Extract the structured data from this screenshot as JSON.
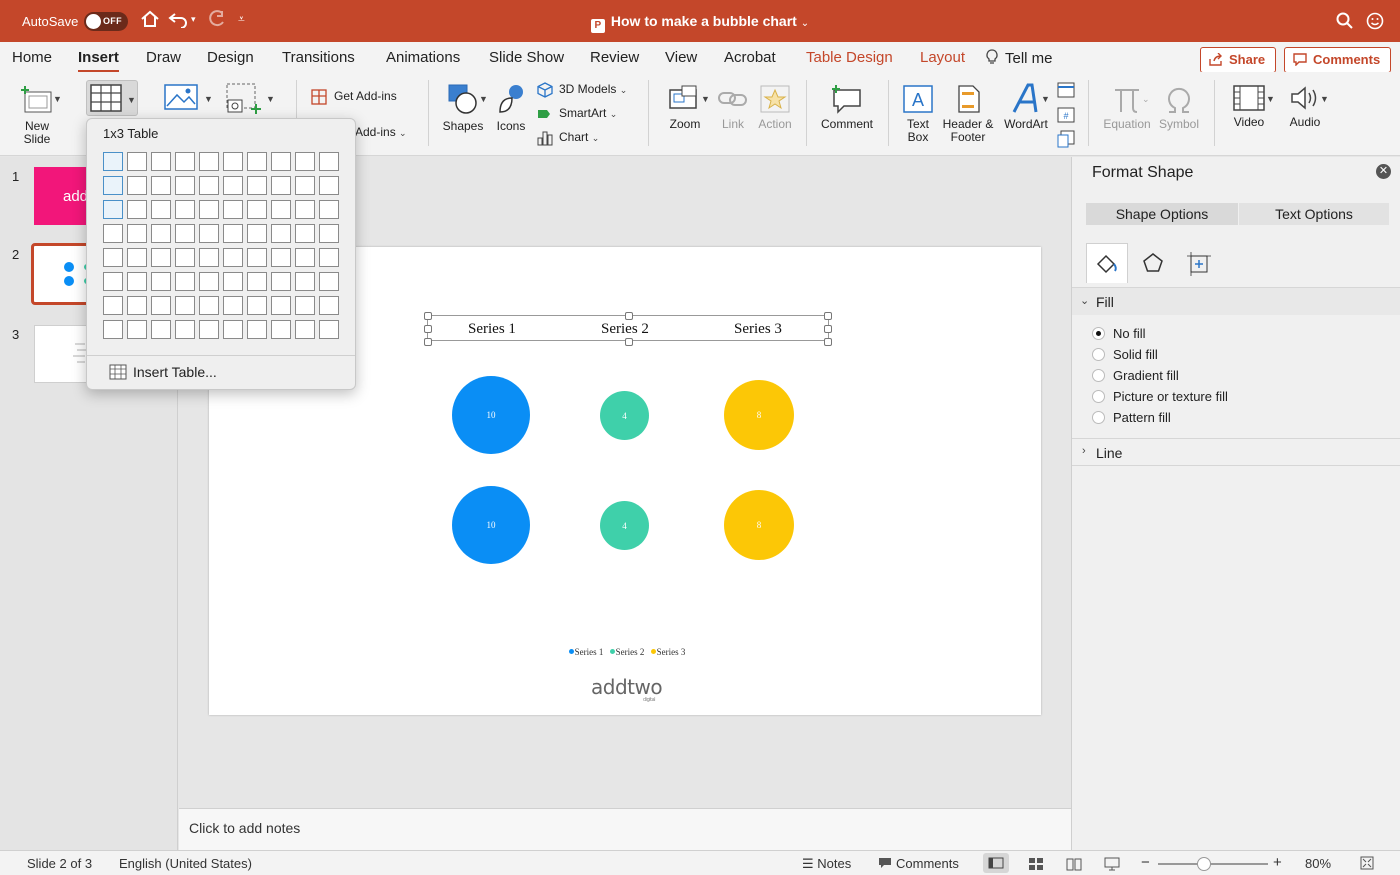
{
  "titlebar": {
    "autosave_label": "AutoSave",
    "autosave_state": "OFF",
    "doc_title": "How to make a bubble chart",
    "app_badge": "P",
    "accent_color": "#c4472a"
  },
  "tabs": {
    "home": "Home",
    "insert": "Insert",
    "draw": "Draw",
    "design": "Design",
    "transitions": "Transitions",
    "animations": "Animations",
    "slide_show": "Slide Show",
    "review": "Review",
    "view": "View",
    "acrobat": "Acrobat",
    "table_design": "Table Design",
    "layout": "Layout",
    "tell_me": "Tell me",
    "share": "Share",
    "comments": "Comments"
  },
  "ribbon": {
    "new_slide": "New",
    "new_slide_2": "Slide",
    "get_addins": "Get Add-ins",
    "my_addins": "Add-ins",
    "shapes": "Shapes",
    "icons": "Icons",
    "models_3d": "3D Models",
    "smartart": "SmartArt",
    "chart": "Chart",
    "zoom": "Zoom",
    "link": "Link",
    "action": "Action",
    "comment": "Comment",
    "text_box": "Text",
    "text_box_2": "Box",
    "header_footer": "Header &",
    "header_footer_2": "Footer",
    "wordart": "WordArt",
    "equation": "Equation",
    "symbol": "Symbol",
    "video": "Video",
    "audio": "Audio"
  },
  "table_menu": {
    "title": "1x3 Table",
    "rows": 8,
    "cols": 10,
    "highlight_rows": 3,
    "highlight_cols": 1,
    "insert_label": "Insert Table..."
  },
  "thumbnails": {
    "items": [
      {
        "num": "1",
        "text": "add"
      },
      {
        "num": "2",
        "text": ""
      },
      {
        "num": "3",
        "text": ""
      }
    ]
  },
  "slide": {
    "table_headers": [
      "Series 1",
      "Series 2",
      "Series 3"
    ],
    "bubbles": [
      {
        "label": "10",
        "color": "#0a8ef5"
      },
      {
        "label": "4",
        "color": "#3fd0aa"
      },
      {
        "label": "8",
        "color": "#fcc706"
      },
      {
        "label": "10",
        "color": "#0a8ef5"
      },
      {
        "label": "4",
        "color": "#3fd0aa"
      },
      {
        "label": "8",
        "color": "#fcc706"
      }
    ],
    "legend": [
      {
        "name": "Series 1",
        "color": "#0a8ef5"
      },
      {
        "name": "Series 2",
        "color": "#3fd0aa"
      },
      {
        "name": "Series 3",
        "color": "#fcc706"
      }
    ],
    "logo_text": "addtwo",
    "logo_sub": "digital"
  },
  "notes": {
    "placeholder": "Click to add notes"
  },
  "format_pane": {
    "title": "Format Shape",
    "shape_options": "Shape Options",
    "text_options": "Text Options",
    "fill_section": "Fill",
    "fill_options": [
      "No fill",
      "Solid fill",
      "Gradient fill",
      "Picture or texture fill",
      "Pattern fill"
    ],
    "selected_fill": 0,
    "line_section": "Line"
  },
  "status": {
    "slide_info": "Slide 2 of 3",
    "language": "English (United States)",
    "notes": "Notes",
    "comments": "Comments",
    "zoom": "80%",
    "zoom_fraction": 0.42
  }
}
